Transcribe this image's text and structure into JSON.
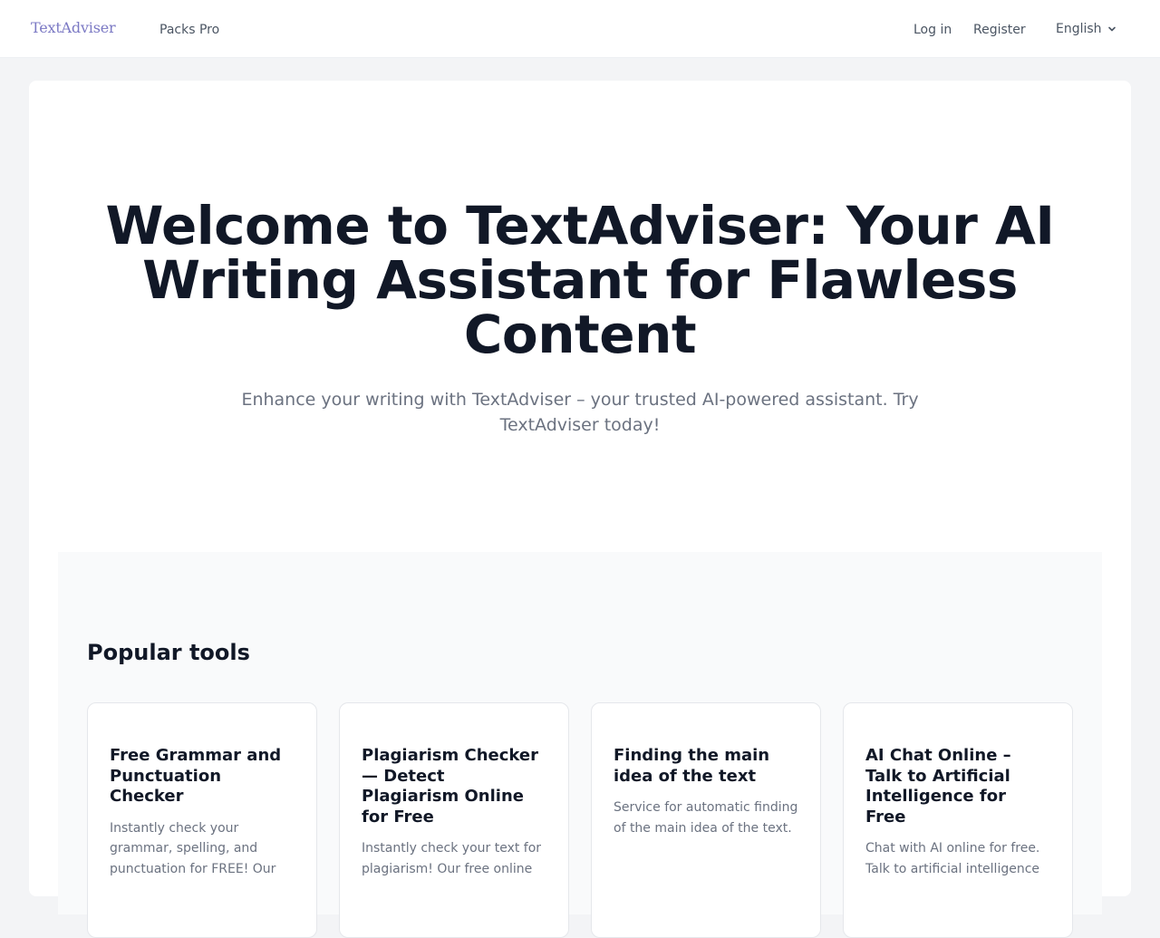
{
  "header": {
    "brand": "TextAdviser",
    "nav": {
      "packs": "Packs Pro",
      "login": "Log in",
      "register": "Register"
    },
    "language": {
      "selected": "English",
      "icon": "chevron-down-icon"
    }
  },
  "hero": {
    "title": "Welcome to TextAdviser: Your AI Writing Assistant for Flawless Content",
    "subtitle": "Enhance your writing with TextAdviser – your trusted AI-powered assistant. Try TextAdviser today!"
  },
  "tools": {
    "heading": "Popular tools",
    "items": [
      {
        "title": "Free Grammar and Punctuation Checker",
        "description": "Instantly check your grammar, spelling, and punctuation for FREE! Our"
      },
      {
        "title": "Plagiarism Checker — Detect Plagiarism Online for Free",
        "description": "Instantly check your text for plagiarism! Our free online"
      },
      {
        "title": "Finding the main idea of the text",
        "description": "Service for automatic finding of the main idea of the text."
      },
      {
        "title": "AI Chat Online – Talk to Artificial Intelligence for Free",
        "description": "Chat with AI online for free. Talk to artificial intelligence"
      }
    ]
  },
  "colors": {
    "brand": "#7b79c4",
    "page_background": "#f3f4f6",
    "heading": "#111827",
    "muted_text": "#6b7280"
  }
}
